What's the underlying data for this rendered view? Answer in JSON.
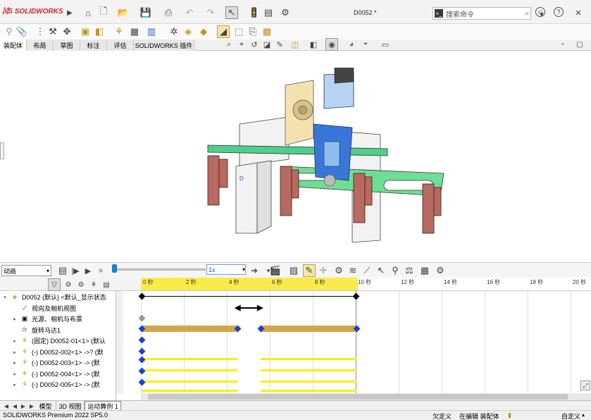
{
  "app": {
    "logo": "SOLIDWORKS",
    "document_title": "D0052 *",
    "search_placeholder": "搜索命令"
  },
  "tabs": [
    "装配体",
    "布局",
    "草图",
    "标注",
    "评估",
    "SOLIDWORKS 插件"
  ],
  "motion": {
    "study_type": "动画",
    "speed": "1x",
    "ruler_ticks": [
      "0 秒",
      "2 秒",
      "4 秒",
      "6 秒",
      "8 秒",
      "10 秒",
      "12 秒",
      "14 秒",
      "16 秒",
      "18 秒",
      "20 秒"
    ]
  },
  "tree": [
    "D0052 (默认) <默认_显示状态",
    "视向及相机视图",
    "光源、相机与布景",
    "旋转马达1",
    "(固定) D0052-01<1> (默认",
    "(-) D0052-002<1> ->? (默",
    "(-) D0052-003<1> -> (默",
    "(-) D0052-004<1> -> (默",
    "(-) D0052-005<1> -> (默"
  ],
  "bottom_tabs": [
    "模型",
    "3D 视图",
    "运动算例 1"
  ],
  "status": {
    "product": "SOLIDWORKS Premium 2022 SP5.0",
    "underdefined": "欠定义",
    "editing": "在编辑 装配体",
    "custom": "自定义"
  },
  "colors": {
    "motor_bar": "#d3a64a",
    "component_bar": "#ffee00",
    "key_diamond": "#1a3fd6"
  }
}
